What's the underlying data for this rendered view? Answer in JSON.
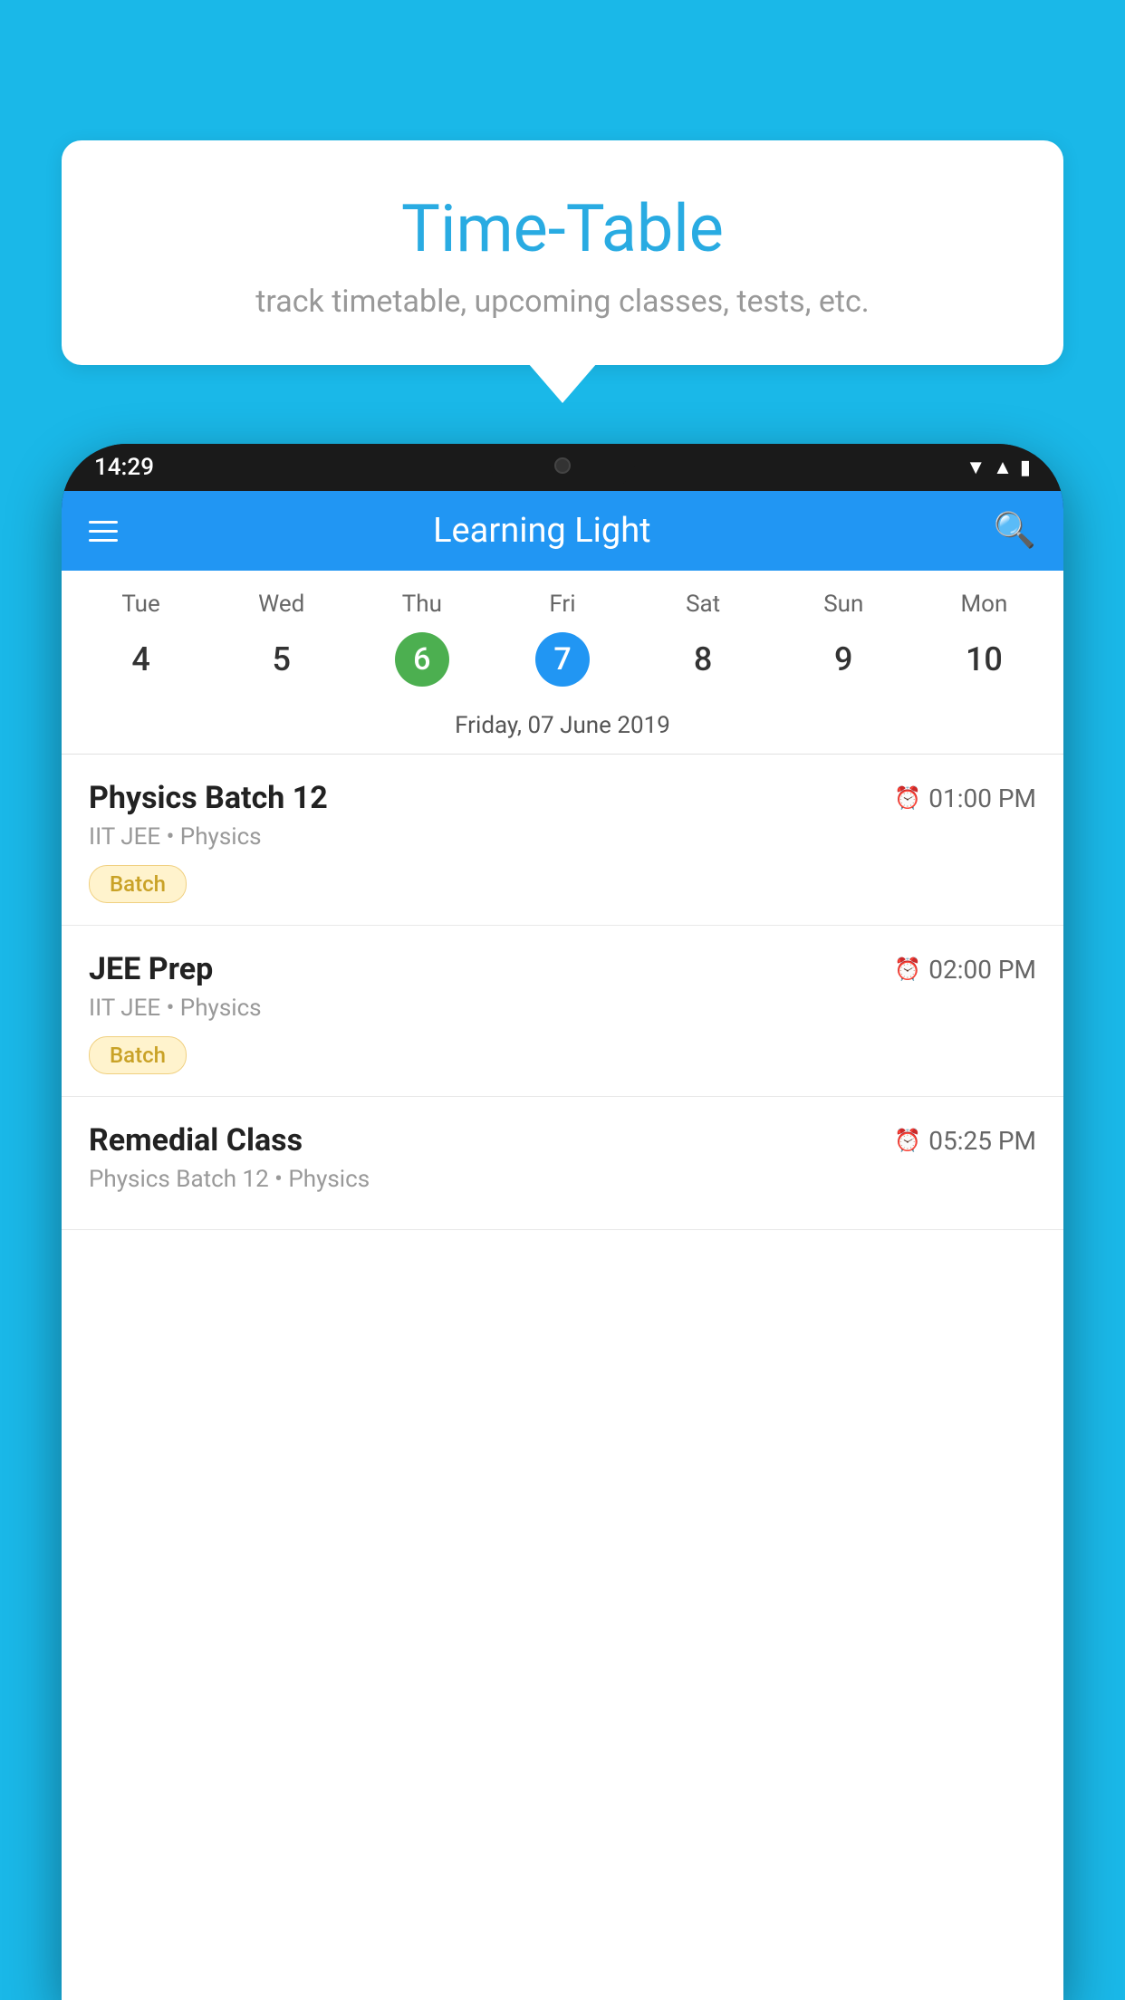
{
  "background_color": "#1ab8e8",
  "bubble": {
    "title": "Time-Table",
    "subtitle": "track timetable, upcoming classes, tests, etc."
  },
  "phone": {
    "status_bar": {
      "time": "14:29"
    },
    "app_header": {
      "title": "Learning Light"
    },
    "calendar": {
      "days": [
        "Tue",
        "Wed",
        "Thu",
        "Fri",
        "Sat",
        "Sun",
        "Mon"
      ],
      "dates": [
        "4",
        "5",
        "6",
        "7",
        "8",
        "9",
        "10"
      ],
      "today_index": 2,
      "selected_index": 3,
      "selected_date_label": "Friday, 07 June 2019"
    },
    "schedule": [
      {
        "title": "Physics Batch 12",
        "time": "01:00 PM",
        "subtitle": "IIT JEE • Physics",
        "tag": "Batch"
      },
      {
        "title": "JEE Prep",
        "time": "02:00 PM",
        "subtitle": "IIT JEE • Physics",
        "tag": "Batch"
      },
      {
        "title": "Remedial Class",
        "time": "05:25 PM",
        "subtitle": "Physics Batch 12 • Physics",
        "tag": ""
      }
    ]
  }
}
